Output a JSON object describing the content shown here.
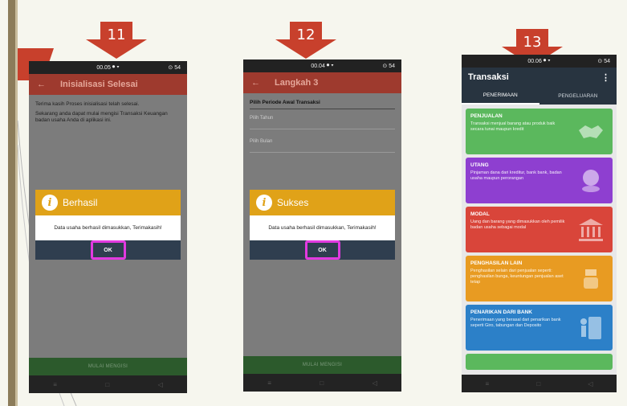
{
  "colors": {
    "arrow": "#c8402c",
    "dialog_header": "#e0a218",
    "dialog_footer": "#2f3e4f",
    "highlight": "#e23ae0",
    "appbar_red": "#9e3a2e",
    "appbar_dark": "#283440"
  },
  "steps": [
    {
      "number": "11"
    },
    {
      "number": "12"
    },
    {
      "number": "13"
    }
  ],
  "phone11": {
    "status_time": "00.05",
    "status_right": "⊙ 54",
    "back_icon": "arrow-left-icon",
    "appbar_title": "Inisialisasi Selesai",
    "body_line1": "Terima kasih Proses inisialisasi telah selesai.",
    "body_line2": "Sekarang anda dapat mulai mengisi Transaksi Keuangan badan usaha Anda di aplikasi ini.",
    "dialog_icon": "info-icon",
    "dialog_title": "Berhasil",
    "dialog_message": "Data usaha berhasil dimasukkan, Terimakasih!",
    "ok_label": "OK",
    "bottom_button": "MULAI MENGISI"
  },
  "phone12": {
    "status_time": "00.04",
    "status_right": "⊙ 54",
    "back_icon": "arrow-left-icon",
    "appbar_title": "Langkah 3",
    "section_title": "Pilih Periode Awal Transaksi",
    "field_year": "Pilih Tahun",
    "field_month": "Pilih Bulan",
    "dialog_icon": "info-icon",
    "dialog_title": "Sukses",
    "dialog_message": "Data usaha berhasil dimasukkan, Terimakasih!",
    "ok_label": "OK",
    "bottom_button": "MULAI MENGISI"
  },
  "phone13": {
    "status_time": "00.06",
    "status_right": "⊙ 54",
    "appbar_title": "Transaksi",
    "menu_icon": "more-vertical-icon",
    "tabs": [
      {
        "label": "PENERIMAAN",
        "active": true
      },
      {
        "label": "PENGELUARAN",
        "active": false
      }
    ],
    "cards": [
      {
        "title": "PENJUALAN",
        "desc": "Transaksi menjual barang atau produk baik secara tunai maupun kredit",
        "color": "#5bb85d",
        "icon": "handshake-icon"
      },
      {
        "title": "UTANG",
        "desc": "Pinjaman dana dari kreditur, bank bank, badan usaha maupun perorangan",
        "color": "#8e3fd0",
        "icon": "coins-icon"
      },
      {
        "title": "MODAL",
        "desc": "Uang dan barang yang dimasukkan oleh pemilik badan usaha sebagai modal",
        "color": "#d9453a",
        "icon": "bank-icon"
      },
      {
        "title": "PENGHASILAN LAIN",
        "desc": "Penghasilan selain dari penjualan seperti: penghasilan bunga, keuntungan penjualan aset tetap",
        "color": "#e89b22",
        "icon": "money-hand-icon"
      },
      {
        "title": "PENARIKAN DARI BANK",
        "desc": "Penerimaan yang berasal dari penarikan bank seperti Giro, tabungan dan Deposito",
        "color": "#2c80c8",
        "icon": "atm-icon"
      }
    ]
  }
}
